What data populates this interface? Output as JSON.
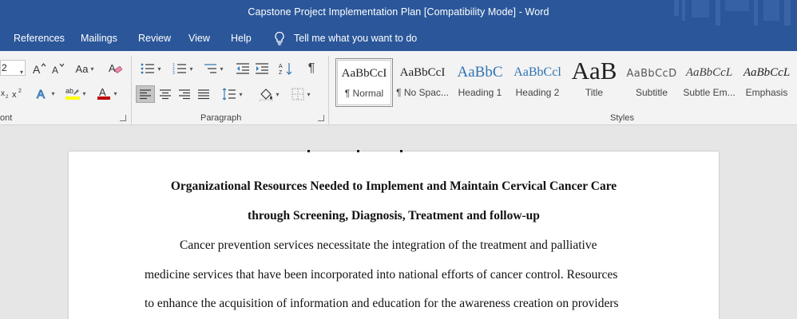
{
  "window": {
    "title": "Capstone Project Implementation Plan [Compatibility Mode]  -  Word"
  },
  "tabs": [
    {
      "label": "References"
    },
    {
      "label": "Mailings"
    },
    {
      "label": "Review"
    },
    {
      "label": "View"
    },
    {
      "label": "Help"
    }
  ],
  "tell_me": {
    "label": "Tell me what you want to do",
    "icon": "lightbulb-icon"
  },
  "font_group": {
    "label": "ont",
    "font_size": "2",
    "case_label": "Aa"
  },
  "paragraph_group": {
    "label": "Paragraph"
  },
  "styles_group": {
    "label": "Styles",
    "items": [
      {
        "sample": "AaBbCcI",
        "name": "¶ Normal"
      },
      {
        "sample": "AaBbCcI",
        "name": "¶ No Spac..."
      },
      {
        "sample": "AaBbC",
        "name": "Heading 1"
      },
      {
        "sample": "AaBbCcl",
        "name": "Heading 2"
      },
      {
        "sample": "AaB",
        "name": "Title"
      },
      {
        "sample": "AaBbCcD",
        "name": "Subtitle"
      },
      {
        "sample": "AaBbCcL",
        "name": "Subtle Em..."
      },
      {
        "sample": "AaBbCcL",
        "name": "Emphasis"
      }
    ]
  },
  "document": {
    "heading_lines": [
      "Organizational Resources Needed to Implement and Maintain Cervical Cancer Care",
      "through Screening, Diagnosis, Treatment and follow-up"
    ],
    "body_lines": [
      "Cancer prevention services necessitate the integration of the treatment and palliative",
      "medicine services that have been incorporated into national efforts of cancer control. Resources",
      "to enhance the acquisition of information and education for the awareness creation on providers"
    ]
  },
  "colors": {
    "title_bar": "#2b579a",
    "ribbon": "#f3f3f3",
    "canvas": "#e6e6e6",
    "highlight": "#ffff00",
    "font_color": "#c00000",
    "heading1_blue": "#2e74b5"
  }
}
